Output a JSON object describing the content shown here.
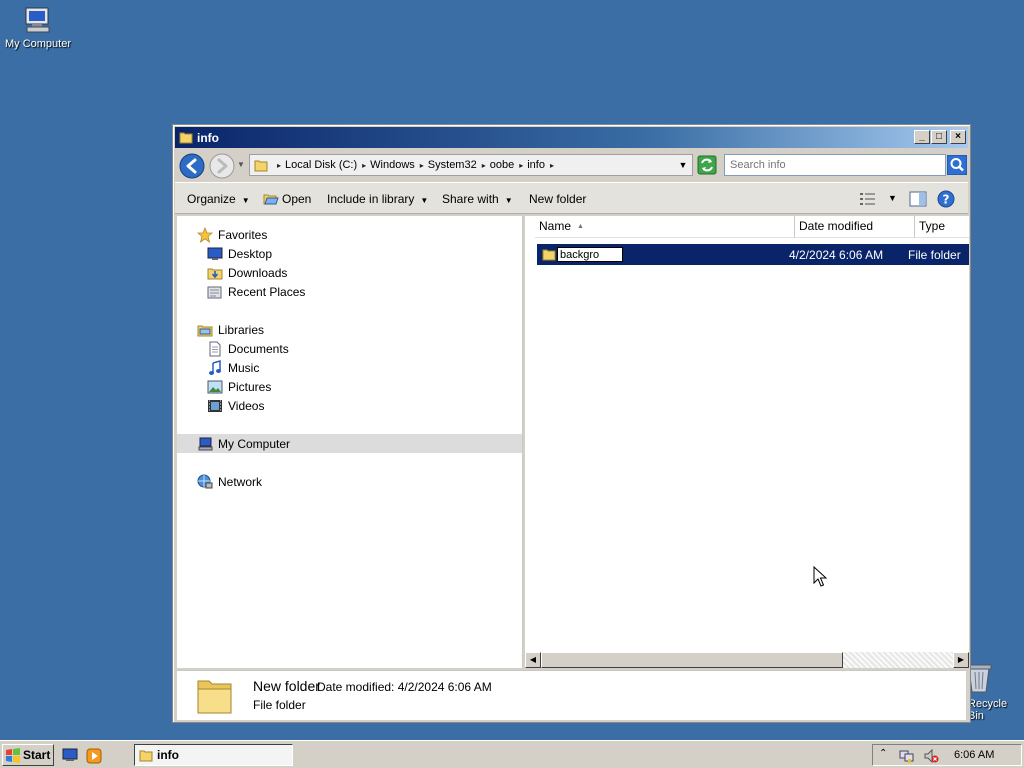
{
  "desktop": {
    "my_computer_label": "My Computer",
    "recycle_bin_label": "Recycle Bin"
  },
  "window": {
    "title": "info",
    "min_glyph": "_",
    "max_glyph": "□",
    "close_glyph": "×"
  },
  "address": {
    "breadcrumb": [
      "Local Disk (C:)",
      "Windows",
      "System32",
      "oobe",
      "info"
    ]
  },
  "search": {
    "placeholder": "Search info"
  },
  "toolbar": {
    "organize": "Organize",
    "open": "Open",
    "include": "Include in library",
    "share": "Share with",
    "new_folder": "New folder"
  },
  "nav": {
    "favorites": "Favorites",
    "desktop": "Desktop",
    "downloads": "Downloads",
    "recent": "Recent Places",
    "libraries": "Libraries",
    "documents": "Documents",
    "music": "Music",
    "pictures": "Pictures",
    "videos": "Videos",
    "my_computer": "My Computer",
    "network": "Network"
  },
  "columns": {
    "name": "Name",
    "date": "Date modified",
    "type": "Type"
  },
  "file": {
    "rename_value": "backgro",
    "date": "4/2/2024 6:06 AM",
    "type": "File folder"
  },
  "details": {
    "name": "New folder",
    "date_line": "Date modified: 4/2/2024 6:06 AM",
    "type": "File folder"
  },
  "taskbar": {
    "start": "Start",
    "task_label": "info",
    "clock": "6:06 AM"
  },
  "colors": {
    "desktop": "#3a6ea5",
    "selection": "#0a246a",
    "title_start": "#0a246a"
  }
}
